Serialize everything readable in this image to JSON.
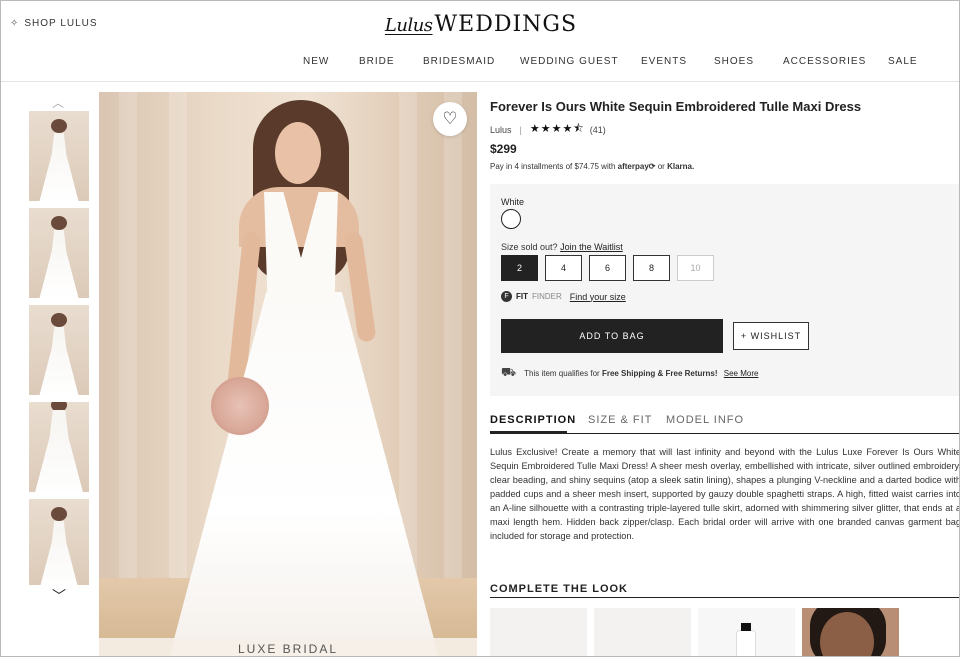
{
  "header": {
    "shop_link": "SHOP LULUS",
    "logo_script": "Lulus",
    "logo_text": "WEDDINGS",
    "nav": [
      "NEW",
      "BRIDE",
      "BRIDESMAID",
      "WEDDING GUEST",
      "EVENTS",
      "SHOES",
      "ACCESSORIES",
      "SALE"
    ]
  },
  "gallery": {
    "thumbnail_count": 5,
    "main_caption": "LUXE BRIDAL",
    "wishlist_icon": "heart-icon"
  },
  "product": {
    "title": "Forever Is Ours White Sequin Embroidered Tulle Maxi Dress",
    "brand": "Lulus",
    "rating": 4.5,
    "stars_display": "★★★★⯪",
    "review_count": "(41)",
    "price": "$299",
    "installments_text": "Pay in 4 installments of $74.75 with",
    "afterpay": "afterpay⟳",
    "installments_or": "or",
    "klarna": "Klarna.",
    "color_label": "White",
    "size_label": "Size sold out?",
    "waitlist_link": "Join the Waitlist",
    "sizes": [
      {
        "label": "2",
        "state": "selected"
      },
      {
        "label": "4",
        "state": "available"
      },
      {
        "label": "6",
        "state": "available"
      },
      {
        "label": "8",
        "state": "available"
      },
      {
        "label": "10",
        "state": "disabled"
      }
    ],
    "fit_icon": "F",
    "fit_bold": "FIT",
    "fit_finder": "FINDER",
    "find_size_link": "Find your size",
    "add_to_bag": "ADD TO BAG",
    "wishlist_button": "+ WISHLIST",
    "shipping_icon": "⛟",
    "shipping_text": "This item qualifies for",
    "shipping_bold": "Free Shipping & Free Returns!",
    "see_more": "See More"
  },
  "tabs": [
    "DESCRIPTION",
    "SIZE & FIT",
    "MODEL INFO"
  ],
  "description": "Lulus Exclusive! Create a memory that will last infinity and beyond with the Lulus Luxe Forever Is Ours White Sequin Embroidered Tulle Maxi Dress! A sheer mesh overlay, embellished with intricate, silver outlined embroidery, clear beading, and shiny sequins (atop a sleek satin lining), shapes a plunging V-neckline and a darted bodice with padded cups and a sheer mesh insert, supported by gauzy double spaghetti straps. A high, fitted waist carries into an A-line silhouette with a contrasting triple-layered tulle skirt, adorned with shimmering silver glitter, that ends at a maxi length hem. Hidden back zipper/clasp. Each bridal order will arrive with one branded canvas garment bag included for storage and protection.",
  "complete_the_look": {
    "title": "COMPLETE THE LOOK"
  },
  "colors": {
    "dark": "#222222",
    "panel": "#f5f5f5"
  }
}
